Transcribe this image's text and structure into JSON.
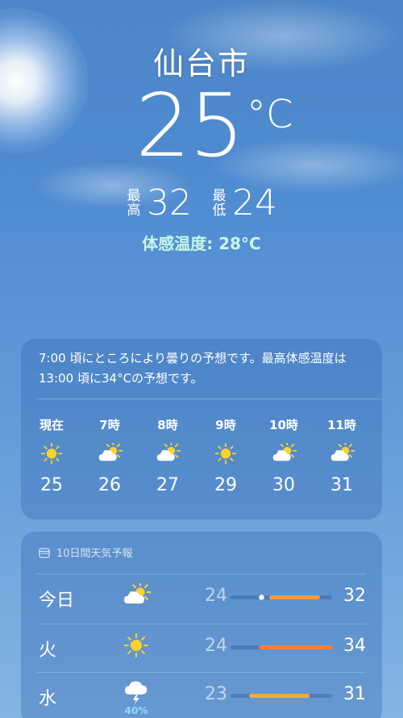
{
  "location": {
    "city": "仙台市"
  },
  "current": {
    "temperature": "25",
    "unit": "°C",
    "high_label": "最高",
    "high": "32",
    "low_label": "最低",
    "low": "24",
    "feels_like": "体感温度: 28°C"
  },
  "hourly_card": {
    "summary": "7:00 頃にところにより曇りの予想です。最高体感温度は13:00 頃に34°Cの予想です。",
    "hours": [
      {
        "label": "現在",
        "icon": "sun-icon",
        "temp": "25"
      },
      {
        "label": "7時",
        "icon": "partly-cloudy-icon",
        "temp": "26"
      },
      {
        "label": "8時",
        "icon": "partly-cloudy-icon",
        "temp": "27"
      },
      {
        "label": "9時",
        "icon": "sun-icon",
        "temp": "29"
      },
      {
        "label": "10時",
        "icon": "partly-cloudy-icon",
        "temp": "30"
      },
      {
        "label": "11時",
        "icon": "partly-cloudy-icon",
        "temp": "31"
      }
    ]
  },
  "daily_card": {
    "title": "10日間天気予報",
    "days": [
      {
        "name": "今日",
        "icon": "partly-cloudy-icon",
        "low": "24",
        "high": "32",
        "precip": "",
        "bar_start": 0.38,
        "bar_end": 0.88,
        "current_dot": 0.3,
        "bar_color": "#f39a3d"
      },
      {
        "name": "火",
        "icon": "sun-icon",
        "low": "24",
        "high": "34",
        "precip": "",
        "bar_start": 0.28,
        "bar_end": 1.0,
        "current_dot": null,
        "bar_color": "#f57f38"
      },
      {
        "name": "水",
        "icon": "thunderstorm-icon",
        "low": "23",
        "high": "31",
        "precip": "40%",
        "bar_start": 0.18,
        "bar_end": 0.78,
        "current_dot": null,
        "bar_color": "#f4a93a"
      }
    ]
  }
}
